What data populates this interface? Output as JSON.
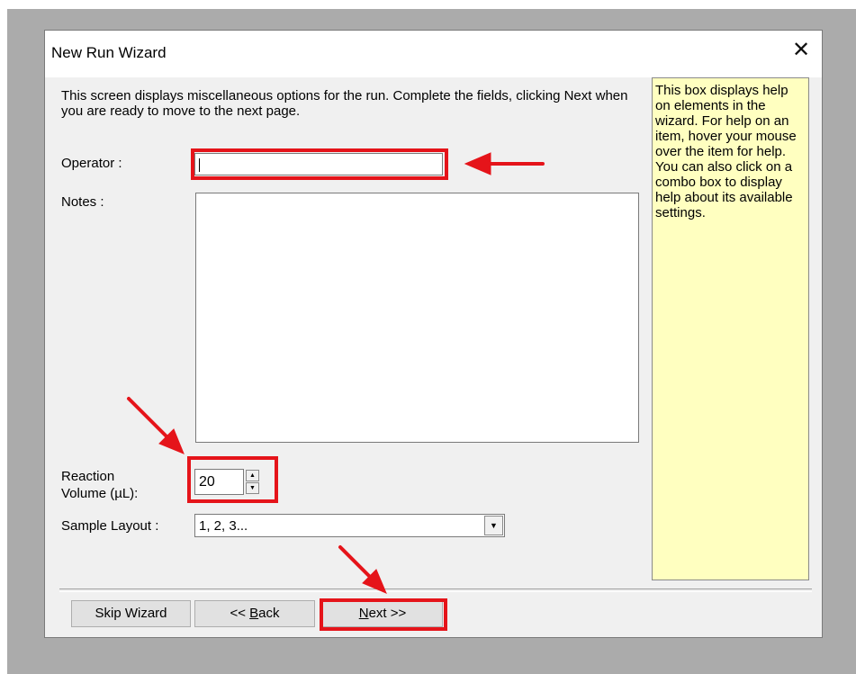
{
  "window": {
    "title": "New Run Wizard",
    "close_glyph": "✕"
  },
  "intro_text": "This screen displays miscellaneous options for the run. Complete the fields, clicking Next when you are ready to move to the next page.",
  "fields": {
    "operator": {
      "label": "Operator :",
      "value": ""
    },
    "notes": {
      "label": "Notes :",
      "value": ""
    },
    "reaction_volume": {
      "label_line1": "Reaction",
      "label_line2": "Volume (µL):",
      "value": "20"
    },
    "sample_layout": {
      "label": "Sample Layout :",
      "value": "1, 2, 3..."
    }
  },
  "help_text": "This box displays help on elements in the wizard. For help on an item, hover your mouse over the item for help. You can also click on a combo box to display help about its available settings.",
  "buttons": {
    "skip_wizard": "Skip Wizard",
    "back_prefix": "<< ",
    "back_mnemonic": "B",
    "back_rest": "ack",
    "next_mnemonic": "N",
    "next_rest": "ext >>"
  },
  "icons": {
    "close": "close-icon",
    "spin_up": "spin-up-icon",
    "spin_down": "spin-down-icon",
    "dropdown": "chevron-down-icon",
    "arrow": "red-arrow-icon"
  },
  "colors": {
    "highlight": "#e5141a",
    "help_bg": "#ffffc0",
    "dialog_bg": "#f0f0f0",
    "backdrop": "#ababab"
  }
}
